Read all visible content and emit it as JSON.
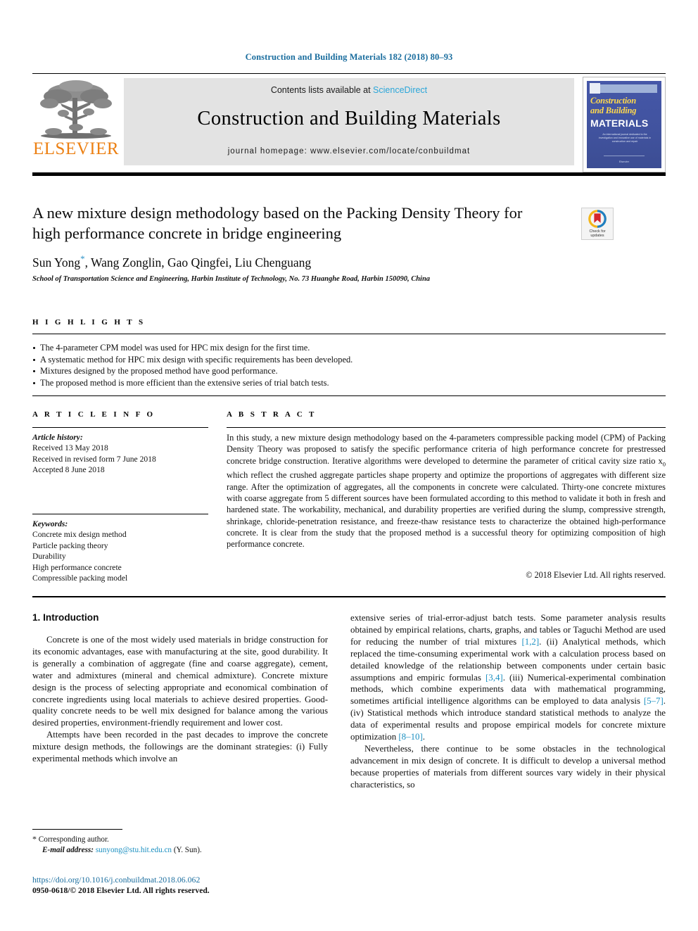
{
  "running_head": "Construction and Building Materials 182 (2018) 80–93",
  "masthead": {
    "publisher_wordmark": "ELSEVIER",
    "contents_prefix": "Contents lists available at ",
    "contents_link": "ScienceDirect",
    "journal_title": "Construction and Building Materials",
    "homepage_line": "journal homepage: www.elsevier.com/locate/conbuildmat",
    "cover": {
      "title_line1": "Construction",
      "title_line2": "and Building",
      "title_line3": "MATERIALS",
      "blurb": "An international journal dedicated to the investigation and innovative use of materials in construction and repair",
      "footer": "Elsevier"
    }
  },
  "article": {
    "title": "A new mixture design methodology based on the Packing Density Theory for high performance concrete in bridge engineering",
    "authors": "Sun Yong, Wang Zonglin, Gao Qingfei, Liu Chenguang",
    "author_star": "*",
    "affiliation": "School of Transportation Science and Engineering, Harbin Institute of Technology, No. 73 Huanghe Road, Harbin 150090, China",
    "crossmark_label_1": "Check for",
    "crossmark_label_2": "updates"
  },
  "highlights": {
    "heading": "H I G H L I G H T S",
    "items": [
      "The 4-parameter CPM model was used for HPC mix design for the first time.",
      "A systematic method for HPC mix design with specific requirements has been developed.",
      "Mixtures designed by the proposed method have good performance.",
      "The proposed method is more efficient than the extensive series of trial batch tests."
    ]
  },
  "article_info": {
    "heading": "A R T I C L E   I N F O",
    "history_label": "Article history:",
    "history": [
      "Received 13 May 2018",
      "Received in revised form 7 June 2018",
      "Accepted 8 June 2018"
    ],
    "keywords_label": "Keywords:",
    "keywords": [
      "Concrete mix design method",
      "Particle packing theory",
      "Durability",
      "High performance concrete",
      "Compressible packing model"
    ]
  },
  "abstract": {
    "heading": "A B S T R A C T",
    "text_part1": "In this study, a new mixture design methodology based on the 4-parameters compressible packing model (CPM) of Packing Density Theory was proposed to satisfy the specific performance criteria of high performance concrete for prestressed concrete bridge construction. Iterative algorithms were developed to determine the parameter of critical cavity size ratio x",
    "subscript": "0",
    "text_part2": " which reflect the crushed aggregate particles shape property and optimize the proportions of aggregates with different size range. After the optimization of aggregates, all the components in concrete were calculated. Thirty-one concrete mixtures with coarse aggregate from 5 different sources have been formulated according to this method to validate it both in fresh and hardened state. The workability, mechanical, and durability properties are verified during the slump, compressive strength, shrinkage, chloride-penetration resistance, and freeze-thaw resistance tests to characterize the obtained high-performance concrete. It is clear from the study that the proposed method is a successful theory for optimizing composition of high performance concrete.",
    "copyright": "© 2018 Elsevier Ltd. All rights reserved."
  },
  "introduction": {
    "heading": "1. Introduction",
    "left_p1": "Concrete is one of the most widely used materials in bridge construction for its economic advantages, ease with manufacturing at the site, good durability. It is generally a combination of aggregate (fine and coarse aggregate), cement, water and admixtures (mineral and chemical admixture). Concrete mixture design is the process of selecting appropriate and economical combination of concrete ingredients using local materials to achieve desired properties. Good-quality concrete needs to be well mix designed for balance among the various desired properties, environment-friendly requirement and lower cost.",
    "left_p2": "Attempts have been recorded in the past decades to improve the concrete mixture design methods, the followings are the dominant strategies: (i) Fully experimental methods which involve an",
    "right_p1_a": "extensive series of trial-error-adjust batch tests. Some parameter analysis results obtained by empirical relations, charts, graphs, and tables or Taguchi Method are used for reducing the number of trial mixtures ",
    "right_ref1": "[1,2]",
    "right_p1_b": ". (ii) Analytical methods, which replaced the time-consuming experimental work with a calculation process based on detailed knowledge of the relationship between components under certain basic assumptions and empiric formulas ",
    "right_ref2": "[3,4]",
    "right_p1_c": ". (iii) Numerical-experimental combination methods, which combine experiments data with mathematical programming, sometimes artificial intelligence algorithms can be employed to data analysis ",
    "right_ref3": "[5–7]",
    "right_p1_d": ". (iv) Statistical methods which introduce standard statistical methods to analyze the data of experimental results and propose empirical models for concrete mixture optimization ",
    "right_ref4": "[8–10]",
    "right_p1_e": ".",
    "right_p2": "Nevertheless, there continue to be some obstacles in the technological advancement in mix design of concrete. It is difficult to develop a universal method because properties of materials from different sources vary widely in their physical characteristics, so"
  },
  "footer": {
    "corresponding_star": "*",
    "corresponding_label": "Corresponding author.",
    "email_label": "E-mail address:",
    "email": "sunyong@stu.hit.edu.cn",
    "email_suffix": "(Y. Sun).",
    "doi": "https://doi.org/10.1016/j.conbuildmat.2018.06.062",
    "issn_line": "0950-0618/© 2018 Elsevier Ltd. All rights reserved."
  },
  "colors": {
    "link_blue": "#1a8fc1",
    "running_head_blue": "#1a6d9e",
    "sciencedirect_blue": "#2ba6d9",
    "elsevier_orange": "#ec8013",
    "cover_blue": "#41539f",
    "cover_yellow": "#ffd84d"
  }
}
